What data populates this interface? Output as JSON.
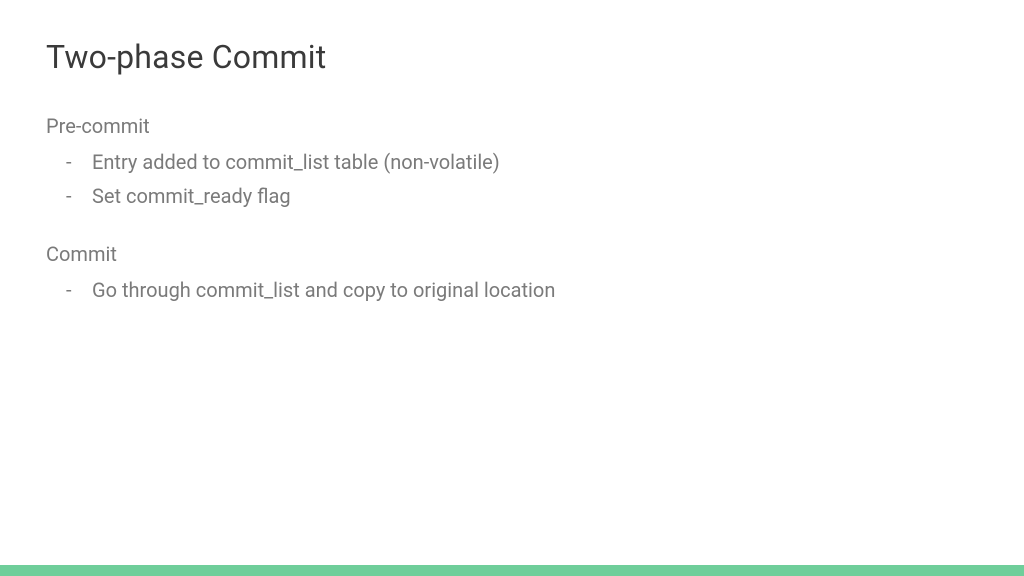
{
  "title": "Two-phase Commit",
  "sections": [
    {
      "label": "Pre-commit",
      "items": [
        "Entry added to commit_list table (non-volatile)",
        "Set commit_ready flag"
      ]
    },
    {
      "label": "Commit",
      "items": [
        "Go through commit_list and copy to original location"
      ]
    }
  ],
  "accent_color": "#6fce9a"
}
